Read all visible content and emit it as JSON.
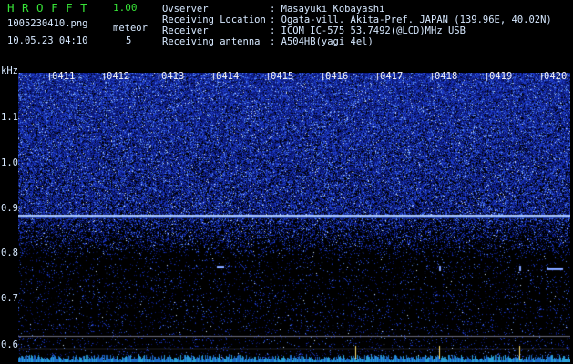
{
  "header": {
    "app_title": "HROFFT",
    "app_version": "1.00",
    "file_name": "1005230410.png",
    "meteor_label": "meteor",
    "capture_time": "10.05.23 04:10",
    "meteor_count": "5"
  },
  "station_info": [
    {
      "label": "Ovserver",
      "value": ": Masayuki Kobayashi"
    },
    {
      "label": "Receiving Location",
      "value": ": Ogata-vill. Akita-Pref. JAPAN (139.96E, 40.02N)"
    },
    {
      "label": "Receiver",
      "value": ": ICOM IC-575 53.7492(@LCD)MHz USB"
    },
    {
      "label": "Receiving antenna",
      "value": ": A504HB(yagi 4el)"
    }
  ],
  "spectrogram": {
    "unit_label": "kHz",
    "y_axis_ticks": [
      "1.1",
      "1.0",
      "0.9",
      "0.8",
      "0.7",
      "0.6"
    ],
    "time_labels": [
      "0411",
      "0412",
      "0413",
      "0414",
      "0415",
      "0416",
      "0417",
      "0418",
      "0419",
      "0420"
    ],
    "colors": {
      "background": "#000000",
      "noise": "#1e3cc8",
      "line": "#aac8ff",
      "event": "#ffe070"
    }
  }
}
